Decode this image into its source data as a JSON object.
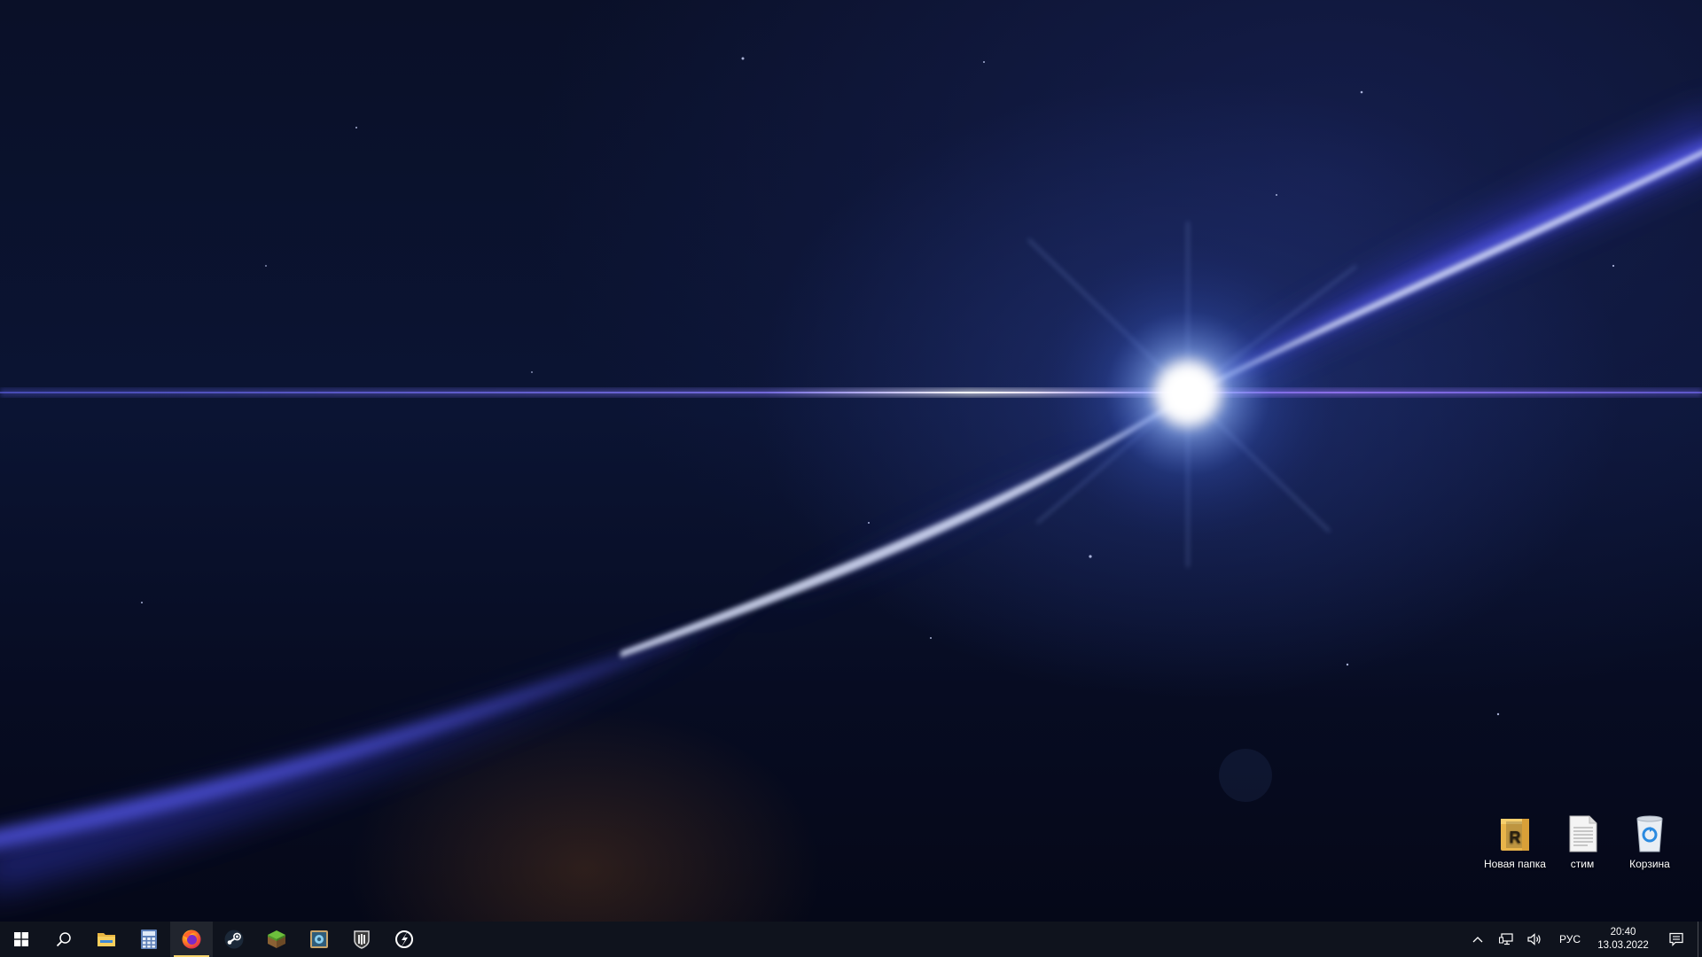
{
  "desktop": {
    "icons": [
      {
        "label": "Новая папка",
        "icon": "folder-icon"
      },
      {
        "label": "стим",
        "icon": "text-document-icon"
      },
      {
        "label": "Корзина",
        "icon": "recycle-bin-icon"
      }
    ]
  },
  "taskbar": {
    "buttons": [
      {
        "name": "start",
        "icon": "windows-logo-icon"
      },
      {
        "name": "search",
        "icon": "search-icon"
      },
      {
        "name": "file-explorer",
        "icon": "folder-icon"
      },
      {
        "name": "calculator",
        "icon": "calculator-icon"
      },
      {
        "name": "firefox",
        "icon": "firefox-icon",
        "active": true
      },
      {
        "name": "steam",
        "icon": "steam-icon"
      },
      {
        "name": "minecraft",
        "icon": "minecraft-grass-block-icon"
      },
      {
        "name": "app",
        "icon": "photo-app-icon"
      },
      {
        "name": "world-of-tanks",
        "icon": "tank-shield-icon"
      },
      {
        "name": "launcher",
        "icon": "launcher-icon"
      }
    ],
    "tray": {
      "language": "РУС",
      "time": "20:40",
      "date": "13.03.2022"
    }
  },
  "colors": {
    "accent_active": "#f4d26b",
    "beam": "#5a5cff",
    "taskbar": "#10141e"
  }
}
